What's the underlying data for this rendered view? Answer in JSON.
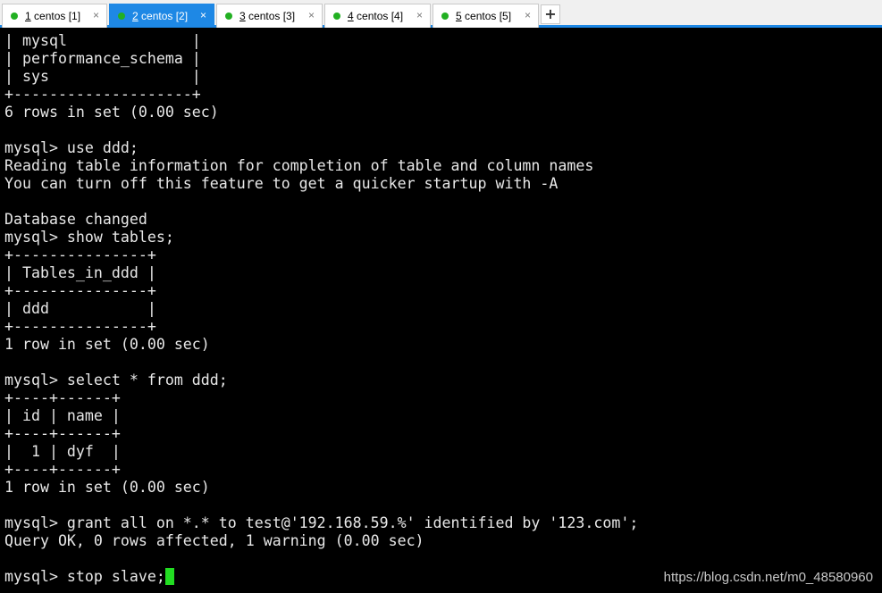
{
  "colors": {
    "tab_active_bg": "#1e88e5",
    "status_dot": "#22b022",
    "cursor": "#22dd22",
    "terminal_text": "#e8e8e8"
  },
  "tabs": [
    {
      "num": "1",
      "label": " centos [1]",
      "close": "×",
      "active": false
    },
    {
      "num": "2",
      "label": " centos [2]",
      "close": "×",
      "active": true
    },
    {
      "num": "3",
      "label": " centos [3]",
      "close": "×",
      "active": false
    },
    {
      "num": "4",
      "label": " centos [4]",
      "close": "×",
      "active": false
    },
    {
      "num": "5",
      "label": " centos [5]",
      "close": "×",
      "active": false
    }
  ],
  "add_tab_label": "+",
  "terminal": {
    "lines": [
      "| mysql              |",
      "| performance_schema |",
      "| sys                |",
      "+--------------------+",
      "6 rows in set (0.00 sec)",
      "",
      "mysql> use ddd;",
      "Reading table information for completion of table and column names",
      "You can turn off this feature to get a quicker startup with -A",
      "",
      "Database changed",
      "mysql> show tables;",
      "+---------------+",
      "| Tables_in_ddd |",
      "+---------------+",
      "| ddd           |",
      "+---------------+",
      "1 row in set (0.00 sec)",
      "",
      "mysql> select * from ddd;",
      "+----+------+",
      "| id | name |",
      "+----+------+",
      "|  1 | dyf  |",
      "+----+------+",
      "1 row in set (0.00 sec)",
      "",
      "mysql> grant all on *.* to test@'192.168.59.%' identified by '123.com';",
      "Query OK, 0 rows affected, 1 warning (0.00 sec)",
      "",
      "mysql> stop slave;"
    ]
  },
  "watermark": "https://blog.csdn.net/m0_48580960"
}
